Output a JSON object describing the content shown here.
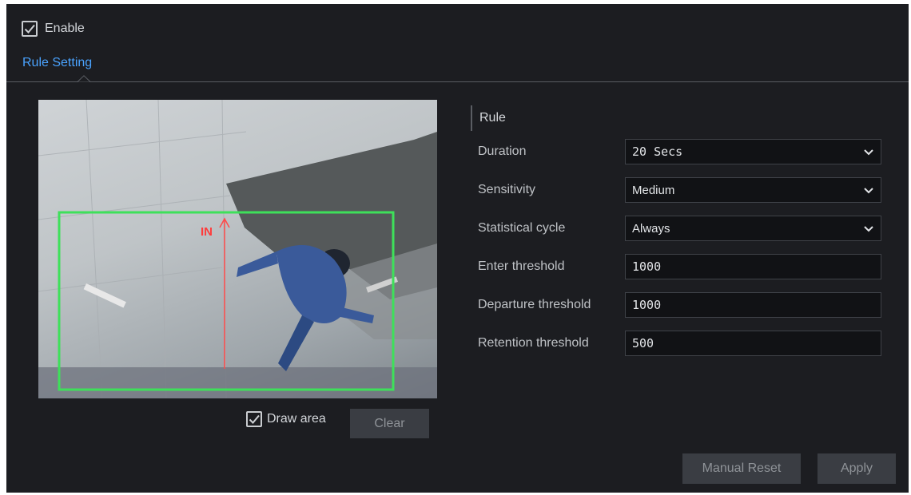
{
  "enable": {
    "label": "Enable",
    "checked": true
  },
  "tabs": [
    {
      "label": "Rule Setting",
      "active": true
    }
  ],
  "preview": {
    "overlay_label": "IN",
    "draw_area": {
      "label": "Draw area",
      "checked": true
    },
    "clear_label": "Clear"
  },
  "rule": {
    "header": "Rule",
    "duration": {
      "label": "Duration",
      "value": "20 Secs"
    },
    "sensitivity": {
      "label": "Sensitivity",
      "value": "Medium"
    },
    "statistical_cycle": {
      "label": "Statistical cycle",
      "value": "Always"
    },
    "enter_threshold": {
      "label": "Enter threshold",
      "value": "1000"
    },
    "departure_threshold": {
      "label": "Departure threshold",
      "value": "1000"
    },
    "retention_threshold": {
      "label": "Retention threshold",
      "value": "500"
    }
  },
  "actions": {
    "manual_reset_label": "Manual Reset",
    "apply_label": "Apply"
  },
  "colors": {
    "background": "#1c1d21",
    "accent": "#4aa3ff",
    "area_box": "#3ee05a",
    "direction_line": "#ff4a4a",
    "button": "#3a3d43"
  },
  "icons": [
    "checkmark-icon",
    "chevron-down-icon",
    "tab-caret-icon"
  ]
}
